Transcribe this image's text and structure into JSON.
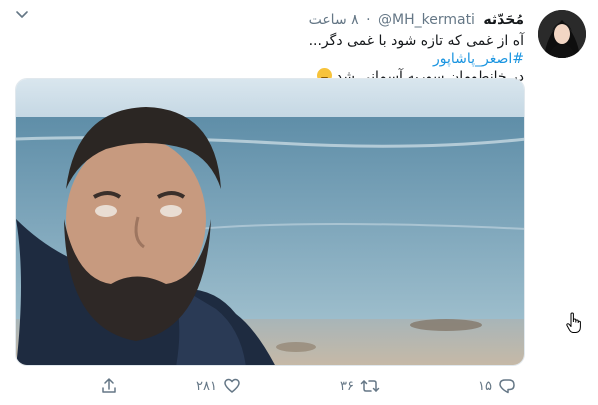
{
  "tweet": {
    "display_name": "مُحَدّثه",
    "handle": "@MH_kermati",
    "separator": "·",
    "time": "۸ ساعت",
    "text_line1": "آه از غمی که تازه شود با غمی دگر...",
    "hashtag": "#اصغر_پاشاپور",
    "text_line3": "در خانطومان سوریه آسمانی شد",
    "emoji": "pensive-face"
  },
  "actions": {
    "reply_count": "۱۵",
    "retweet_count": "۳۶",
    "like_count": "۲۸۱"
  },
  "icons": {
    "menu": "chevron-down-icon",
    "reply": "reply-icon",
    "retweet": "retweet-icon",
    "like": "heart-icon",
    "share": "share-icon",
    "cursor": "hand-pointer-icon"
  },
  "colors": {
    "text": "#14171a",
    "muted": "#657786",
    "link": "#1b95e0",
    "border": "#e1e8ed"
  }
}
